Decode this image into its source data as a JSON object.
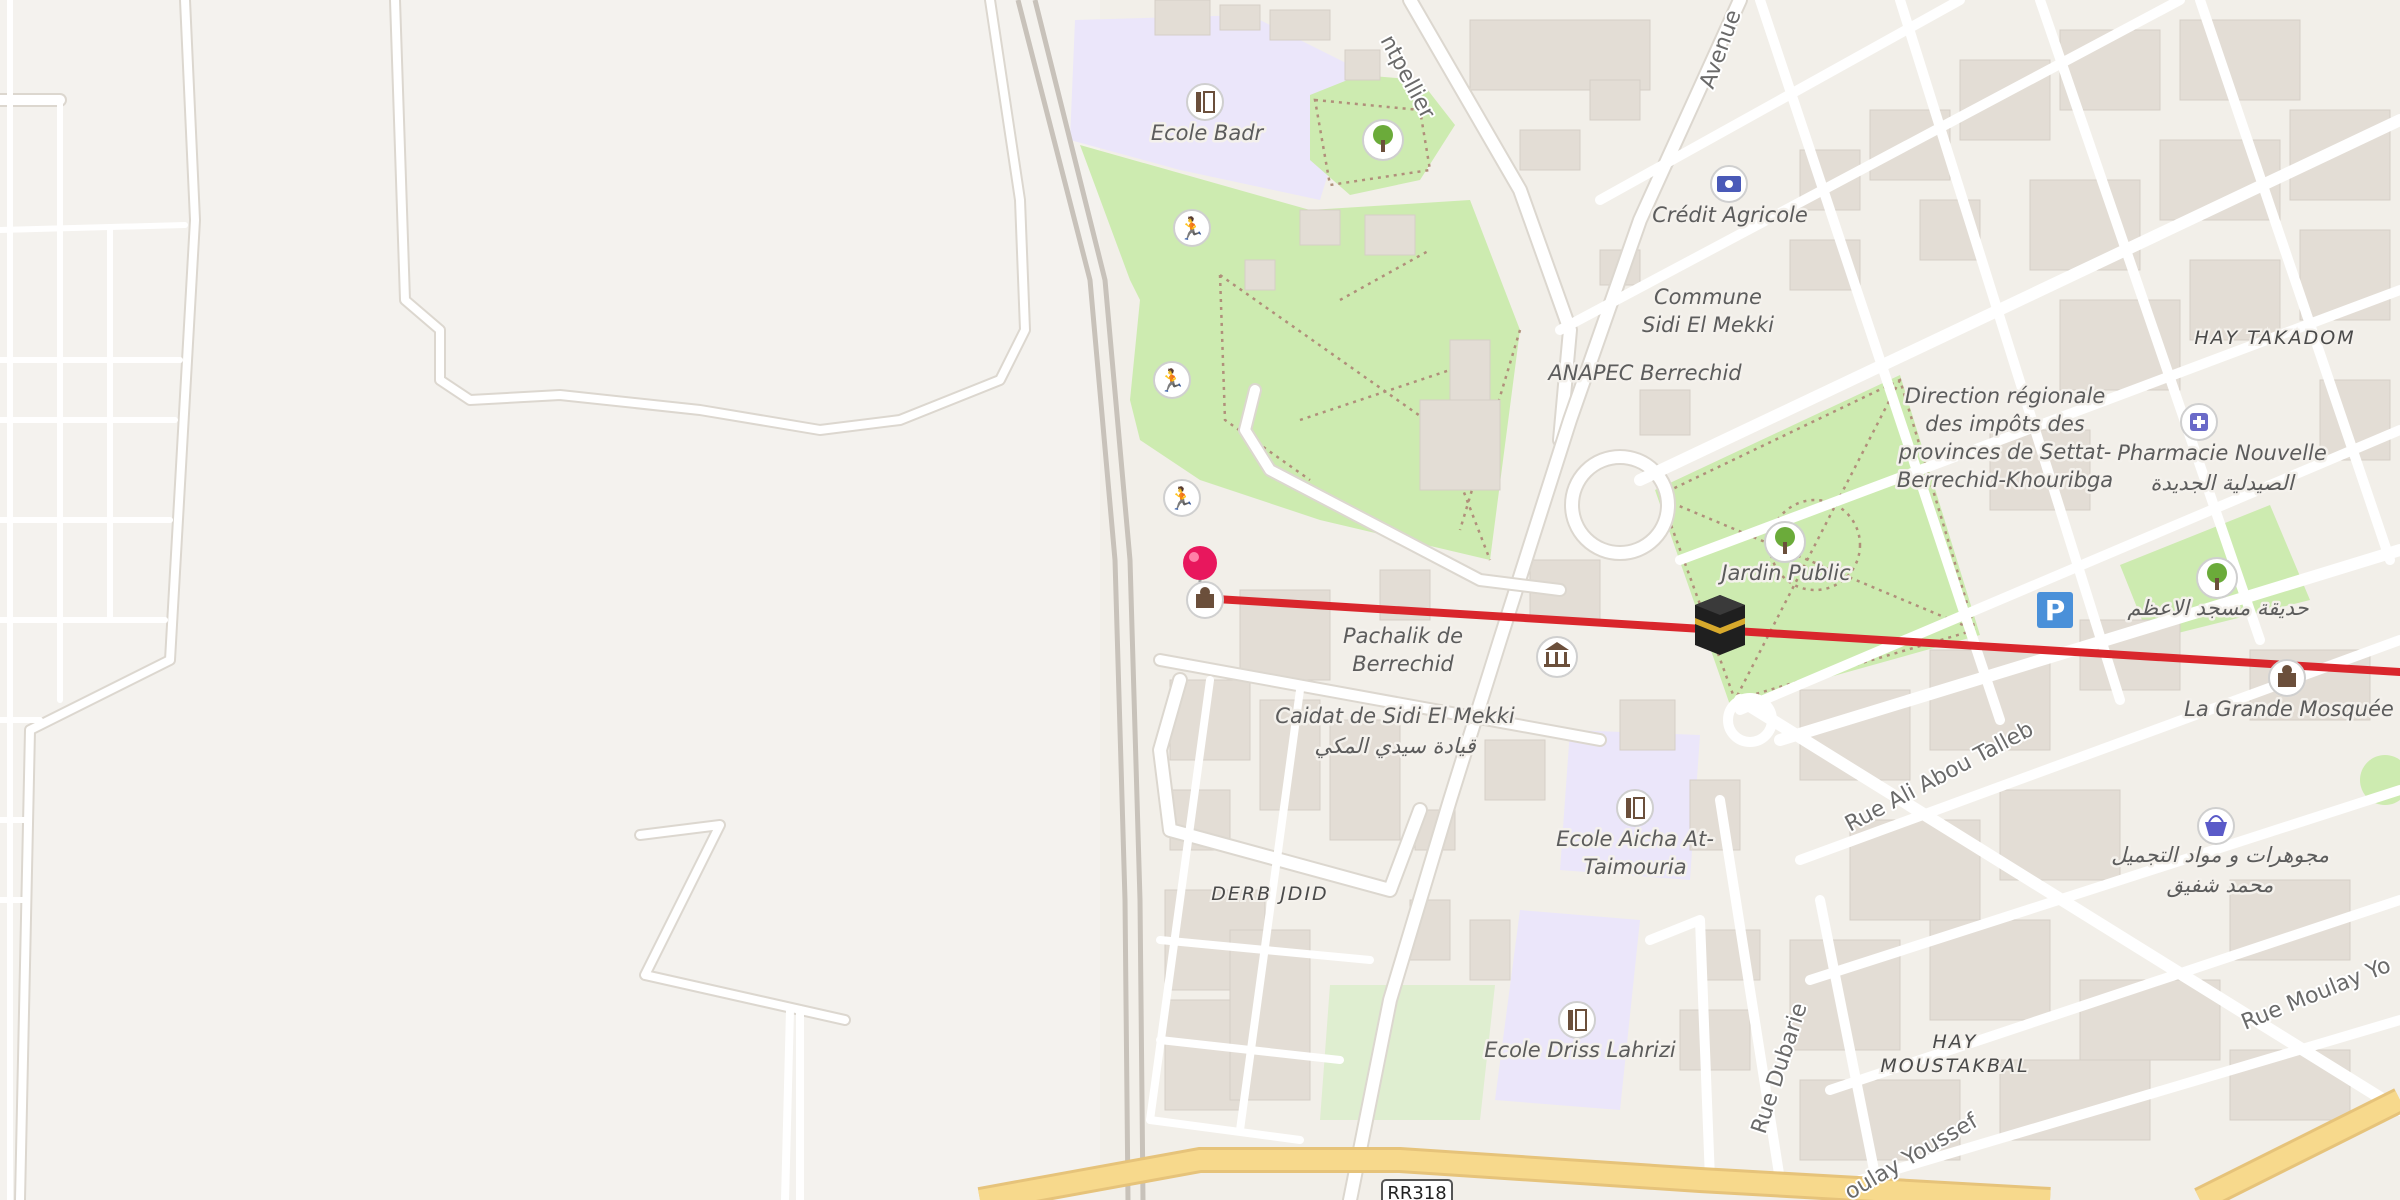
{
  "map": {
    "places": {
      "ecole_badr": "Ecole Badr",
      "credit_agricole": "Crédit Agricole",
      "commune_line1": "Commune",
      "commune_line2": "Sidi El Mekki",
      "anapec": "ANAPEC Berrechid",
      "direction_line1": "Direction régionale",
      "direction_line2": "des impôts des",
      "direction_line3": "provinces de Settat-",
      "direction_line4": "Berrechid-Khouribga",
      "hay_takadom": "HAY TAKADOM",
      "pharmacie_line1": "Pharmacie Nouvelle",
      "pharmacie_line2": "الصيدلية الجديدة",
      "jardin_public": "Jardin Public",
      "hadika": "حديقة مسجد الاعظم",
      "pachalik_line1": "Pachalik de",
      "pachalik_line2": "Berrechid",
      "caidat_line1": "Caidat de Sidi El Mekki",
      "caidat_line2": "قيادة سيدي المكي",
      "grande_mosquee": "La Grande Mosquée",
      "derb_jdid": "DERB JDID",
      "aicha_line1": "Ecole Aicha At-",
      "aicha_line2": "Taimouria",
      "mojawharat_line1": "مجوهرات و مواد التجميل",
      "mojawharat_line2": "محمد شفيق",
      "driss": "Ecole Driss Lahrizi",
      "hay_moustakbal_line1": "HAY",
      "hay_moustakbal_line2": "MOUSTAKBAL"
    },
    "roads": {
      "montpellier": "ntpellier",
      "avenue": "Avenue",
      "ali_abou_talleb": "Rue Ali Abou Talleb",
      "moulay_youssef_right": "Rue Moulay Yo",
      "moulay_youssef_bottom": "oulay Youssef",
      "dubarie": "Rue Dubarie",
      "rr318": "RR318"
    },
    "colors": {
      "land": "#f2efe9",
      "park": "#cdebb0",
      "school": "#ebe6fa",
      "route_line": "#d9262c",
      "pin": "#e8175d",
      "highway": "#f7d98c",
      "parking": "#4a90d9"
    },
    "icons": {
      "school": "school-icon",
      "park": "tree-icon",
      "sport": "running-person-icon",
      "bank": "banknote-icon",
      "pharmacy": "pharmacy-cross-icon",
      "townhall": "government-building-icon",
      "mosque": "mosque-icon",
      "shop": "shopping-basket-icon",
      "parking": "parking-icon",
      "kaaba": "kaaba-icon",
      "pin": "location-pin-icon"
    },
    "parking_label": "P"
  }
}
